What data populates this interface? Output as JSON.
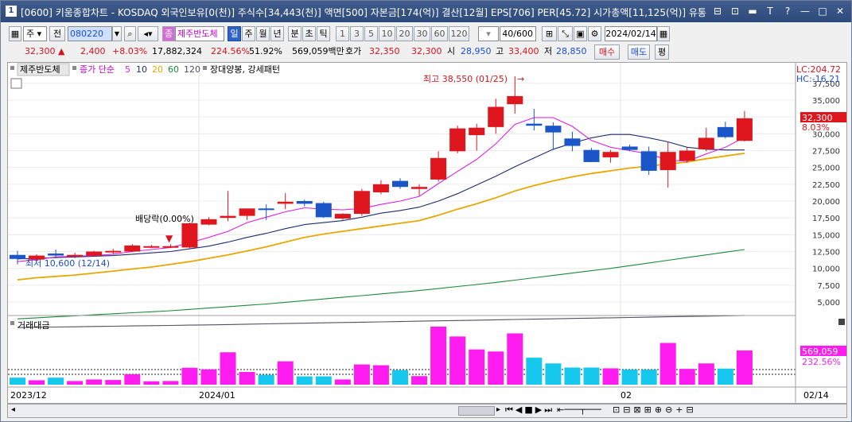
{
  "window": {
    "number": "1",
    "title": "[0600] 키움종합차트 - KOSDAQ 외국인보유[0(천)] 주식수[34,443(천)] 액면[500] 자본금[174(억)] 결산[12월] EPS[706] PER[45.72] 시가총액[11,125(억)] 유통",
    "buttons": [
      "⊟",
      "⊡",
      "▬",
      "T",
      "?",
      "—",
      "□",
      "✕"
    ]
  },
  "toolbar": {
    "period_type": "주",
    "all_label": "전",
    "code": "080220",
    "name_tag": "종",
    "stock_name": "제주반도체",
    "periods": [
      "일",
      "주",
      "월",
      "년",
      "분",
      "초",
      "틱"
    ],
    "selected_period": "일",
    "intervals": [
      "1",
      "3",
      "5",
      "10",
      "20",
      "30",
      "60",
      "120"
    ],
    "count": "40/600",
    "date": "2024/02/14"
  },
  "quote": {
    "price": "32,300",
    "change_arrow": "▲",
    "change": "2,400",
    "change_pct": "+8.03%",
    "volume": "17,882,324",
    "vol_ratio": "224.56%",
    "turnover": "51.92%",
    "amount": "569,059백만",
    "bid_label": "호가",
    "bid": "32,350",
    "ask": "32,300",
    "open_label": "시",
    "open": "28,950",
    "high_label": "고",
    "high": "33,400",
    "low_label": "저",
    "low": "28,850",
    "buy_label": "매수",
    "sell_label": "매도",
    "eval_label": "평"
  },
  "chart": {
    "legend_name": "제주반도체",
    "legend_ma": "종가 단순",
    "ma_periods": [
      "5",
      "10",
      "20",
      "60",
      "120"
    ],
    "ma_colors": [
      "#e020e0",
      "#1a2f6e",
      "#e8a800",
      "#1a8a3a",
      "#505060"
    ],
    "pattern_label": "장대양봉, 강세패턴",
    "lc_label": "LC:204.72",
    "hc_label": "HC:-16.21",
    "high_annotation": "최고 38,550 (01/25)",
    "low_annotation": "최저 10,600 (12/14)",
    "dividend_annotation": "배당락(0.00%)",
    "current_price_tag": "32,300",
    "current_pct_tag": "8.03%",
    "y_ticks": [
      "37,500",
      "35,000",
      "32,500",
      "30,000",
      "27,500",
      "25,000",
      "22,500",
      "20,000",
      "17,500",
      "15,000",
      "12,500",
      "10,000",
      "7,500",
      "5,000"
    ],
    "volume_label": "거래대금",
    "volume_tag": "569,059",
    "volume_pct_tag": "232.56%",
    "x_labels": [
      "2023/12",
      "2024/01",
      "02",
      "02/14"
    ],
    "up_color": "#e0161e",
    "down_color": "#1a56c8",
    "vol_up_color": "#ff1cf0",
    "vol_down_color": "#16c8ee"
  },
  "chart_data": {
    "type": "candlestick",
    "candles": [
      {
        "o": 12000,
        "h": 12600,
        "l": 10600,
        "c": 11400
      },
      {
        "o": 11300,
        "h": 12100,
        "l": 11000,
        "c": 11900
      },
      {
        "o": 12200,
        "h": 12800,
        "l": 11500,
        "c": 11900
      },
      {
        "o": 11800,
        "h": 12300,
        "l": 11500,
        "c": 12000
      },
      {
        "o": 11900,
        "h": 12600,
        "l": 11700,
        "c": 12500
      },
      {
        "o": 12400,
        "h": 12900,
        "l": 12100,
        "c": 12600
      },
      {
        "o": 12500,
        "h": 13600,
        "l": 12400,
        "c": 13400
      },
      {
        "o": 13200,
        "h": 13500,
        "l": 13000,
        "c": 13300
      },
      {
        "o": 13300,
        "h": 13600,
        "l": 13100,
        "c": 13300
      },
      {
        "o": 13100,
        "h": 16800,
        "l": 13000,
        "c": 16700
      },
      {
        "o": 16500,
        "h": 17600,
        "l": 16400,
        "c": 17300
      },
      {
        "o": 17500,
        "h": 21500,
        "l": 17000,
        "c": 17800
      },
      {
        "o": 17800,
        "h": 18500,
        "l": 17200,
        "c": 18900
      },
      {
        "o": 18900,
        "h": 19500,
        "l": 17200,
        "c": 18800
      },
      {
        "o": 19600,
        "h": 21200,
        "l": 18800,
        "c": 19900
      },
      {
        "o": 20000,
        "h": 20200,
        "l": 19200,
        "c": 19600
      },
      {
        "o": 19700,
        "h": 19900,
        "l": 17500,
        "c": 17600
      },
      {
        "o": 17400,
        "h": 18200,
        "l": 17200,
        "c": 18100
      },
      {
        "o": 18100,
        "h": 21800,
        "l": 17800,
        "c": 21500
      },
      {
        "o": 21300,
        "h": 23100,
        "l": 21000,
        "c": 22500
      },
      {
        "o": 23000,
        "h": 23400,
        "l": 21800,
        "c": 22100
      },
      {
        "o": 21800,
        "h": 22500,
        "l": 20800,
        "c": 22100
      },
      {
        "o": 23200,
        "h": 27400,
        "l": 22900,
        "c": 26400
      },
      {
        "o": 27400,
        "h": 31200,
        "l": 27100,
        "c": 30800
      },
      {
        "o": 29800,
        "h": 31500,
        "l": 27500,
        "c": 30900
      },
      {
        "o": 31000,
        "h": 35200,
        "l": 30000,
        "c": 34000
      },
      {
        "o": 34400,
        "h": 38550,
        "l": 33000,
        "c": 35600
      },
      {
        "o": 31500,
        "h": 33700,
        "l": 30500,
        "c": 31200
      },
      {
        "o": 31200,
        "h": 31700,
        "l": 27600,
        "c": 30200
      },
      {
        "o": 29300,
        "h": 30300,
        "l": 27400,
        "c": 28200
      },
      {
        "o": 27600,
        "h": 27900,
        "l": 25800,
        "c": 25800
      },
      {
        "o": 26500,
        "h": 27600,
        "l": 25700,
        "c": 27300
      },
      {
        "o": 28100,
        "h": 28400,
        "l": 27400,
        "c": 27600
      },
      {
        "o": 27400,
        "h": 28100,
        "l": 23900,
        "c": 24500
      },
      {
        "o": 24600,
        "h": 28800,
        "l": 22000,
        "c": 27300
      },
      {
        "o": 26000,
        "h": 28000,
        "l": 25700,
        "c": 27500
      },
      {
        "o": 27700,
        "h": 30900,
        "l": 27400,
        "c": 29400
      },
      {
        "o": 31000,
        "h": 31800,
        "l": 29300,
        "c": 29500
      },
      {
        "o": 28950,
        "h": 33400,
        "l": 28850,
        "c": 32300
      }
    ],
    "ma5": [
      11000,
      11300,
      11700,
      11800,
      11900,
      12100,
      12500,
      12800,
      13100,
      13800,
      14600,
      15500,
      16800,
      17600,
      18400,
      19000,
      18800,
      18700,
      18900,
      19500,
      20000,
      20700,
      22600,
      24400,
      26200,
      28500,
      31400,
      32400,
      32400,
      31100,
      29000,
      28000,
      27500,
      27000,
      26100,
      25900,
      27000,
      28000,
      29500
    ],
    "ma10": [
      11400,
      11500,
      11600,
      11700,
      11800,
      11900,
      12100,
      12300,
      12500,
      12900,
      13300,
      13900,
      14600,
      15200,
      15900,
      16500,
      16800,
      17100,
      17600,
      18200,
      18600,
      19100,
      20000,
      21100,
      22400,
      23700,
      25100,
      26400,
      27700,
      28600,
      29400,
      29900,
      29900,
      29400,
      28800,
      28000,
      27700,
      27600,
      27600
    ],
    "ma20": [
      8300,
      8600,
      8800,
      9000,
      9300,
      9600,
      9900,
      10200,
      10600,
      11000,
      11500,
      12000,
      12600,
      13200,
      13900,
      14600,
      15100,
      15500,
      15900,
      16300,
      16700,
      17100,
      17900,
      18800,
      19600,
      20500,
      21500,
      22300,
      23000,
      23600,
      24100,
      24500,
      24900,
      25200,
      25500,
      25800,
      26300,
      26700,
      27100
    ],
    "ma60": [
      2500,
      2650,
      2800,
      2950,
      3100,
      3250,
      3400,
      3550,
      3700,
      3900,
      4100,
      4300,
      4500,
      4700,
      4950,
      5200,
      5450,
      5700,
      5950,
      6200,
      6450,
      6700,
      7000,
      7300,
      7600,
      7900,
      8250,
      8600,
      8950,
      9300,
      9650,
      10000,
      10400,
      10800,
      11200,
      11600,
      12000,
      12400,
      12800
    ],
    "ma120": [
      1200,
      1240,
      1280,
      1320,
      1360,
      1400,
      1440,
      1480,
      1520,
      1560,
      1600,
      1650,
      1700,
      1750,
      1800,
      1850,
      1900,
      1950,
      2000,
      2050,
      2100,
      2150,
      2200,
      2250,
      2300,
      2350,
      2400,
      2450,
      2500,
      2550,
      2600,
      2650,
      2700,
      2750,
      2800,
      2850,
      2900,
      2950,
      3000
    ],
    "volume_amount": [
      27,
      17,
      27,
      14,
      20,
      18,
      40,
      13,
      14,
      65,
      59,
      125,
      49,
      38,
      90,
      32,
      32,
      20,
      78,
      75,
      56,
      33,
      224,
      186,
      136,
      128,
      198,
      104,
      82,
      66,
      66,
      63,
      58,
      58,
      161,
      61,
      82,
      62,
      132
    ]
  }
}
